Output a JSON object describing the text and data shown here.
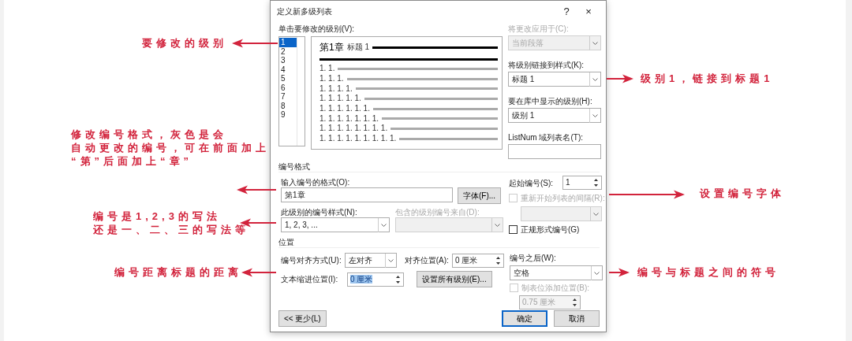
{
  "dialog": {
    "title": "定义新多级列表",
    "help": "?",
    "close": "×",
    "level_list": {
      "label": "单击要修改的级别(V):",
      "items": [
        {
          "label": "1",
          "selected": true
        },
        {
          "label": "2",
          "selected": false
        },
        {
          "label": "3",
          "selected": false
        },
        {
          "label": "4",
          "selected": false
        },
        {
          "label": "5",
          "selected": false
        },
        {
          "label": "6",
          "selected": false
        },
        {
          "label": "7",
          "selected": false
        },
        {
          "label": "8",
          "selected": false
        },
        {
          "label": "9",
          "selected": false
        }
      ]
    },
    "preview": {
      "heading": {
        "text": "第1章",
        "style": "标题 1"
      },
      "lines": [
        "1. 1.",
        "1. 1. 1.",
        "1. 1. 1. 1.",
        "1. 1. 1. 1. 1.",
        "1. 1. 1. 1. 1. 1.",
        "1. 1. 1. 1. 1. 1. 1.",
        "1. 1. 1. 1. 1. 1. 1. 1.",
        "1. 1. 1. 1. 1. 1. 1. 1. 1."
      ]
    },
    "apply_to": {
      "label": "将更改应用于(C):",
      "value": "当前段落",
      "disabled": true
    },
    "link_style": {
      "label": "将级别链接到样式(K):",
      "value": "标题 1",
      "disabled": false
    },
    "gallery_level": {
      "label": "要在库中显示的级别(H):",
      "value": "级别 1",
      "disabled": false
    },
    "listnum_name": {
      "label": "ListNum 域列表名(T):"
    },
    "number_format": {
      "title": "编号格式",
      "format_label": "输入编号的格式(O):",
      "format_value": "第1章",
      "font_button": "字体(F)...",
      "style_label": "此级别的编号样式(N):",
      "style_value": "1, 2, 3, ...",
      "include_label": "包含的级别编号来自(D):",
      "include_disabled": true,
      "start_label": "起始编号(S):",
      "start_value": "1",
      "restart": {
        "label": "重新开始列表的间隔(R):",
        "checked": false,
        "disabled": true
      },
      "legal": {
        "label": "正规形式编号(G)",
        "checked": false,
        "disabled": false
      }
    },
    "position": {
      "title": "位置",
      "align_label": "编号对齐方式(U):",
      "align_value": "左对齐",
      "at_label": "对齐位置(A):",
      "at_value": "0 厘米",
      "indent_label": "文本缩进位置(I):",
      "indent_value": "0 厘米",
      "indent_value_selected": true,
      "set_all_button": "设置所有级别(E)...",
      "follow_label": "编号之后(W):",
      "follow_value": "空格",
      "tab_stop": {
        "label": "制表位添加位置(B):",
        "checked": false,
        "disabled": true
      },
      "tab_value": "0.75 厘米",
      "tab_disabled": true
    },
    "footer": {
      "less_button": "<< 更少(L)",
      "ok_button": "确定",
      "cancel_button": "取消"
    }
  },
  "annotations": [
    {
      "lines": [
        "要修改的级别"
      ],
      "kind": "leftward"
    },
    {
      "lines": [
        "级别1，链接到标题1"
      ],
      "kind": "rightward"
    },
    {
      "lines": [
        "修改编号格式，灰色是会",
        "自动更改的编号，可在前面加上",
        "“第”后面加上“章”"
      ],
      "kind": "leftward"
    },
    {
      "lines": [
        "设置编号字体"
      ],
      "kind": "rightward"
    },
    {
      "lines": [
        "编号是1,2,3的写法",
        "还是一、二、三的写法等"
      ],
      "kind": "leftward"
    },
    {
      "lines": [
        "编号距离标题的距离"
      ],
      "kind": "leftward"
    },
    {
      "lines": [
        "编号与标题之间的符号"
      ],
      "kind": "rightward"
    }
  ]
}
